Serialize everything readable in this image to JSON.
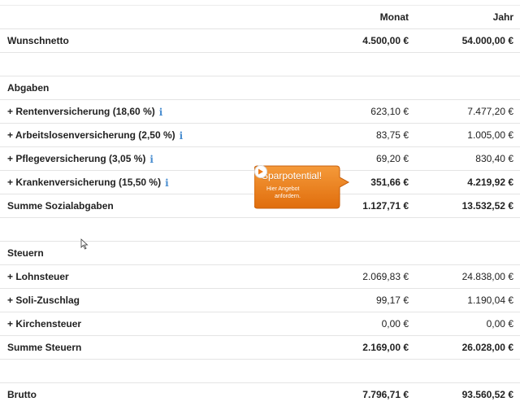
{
  "header": {
    "monat": "Monat",
    "jahr": "Jahr"
  },
  "rows": [
    {
      "label": "Wunschnetto",
      "monat": "4.500,00 €",
      "jahr": "54.000,00 €"
    },
    {
      "label": "",
      "monat": "",
      "jahr": ""
    },
    {
      "label": "Abgaben",
      "monat": "",
      "jahr": ""
    },
    {
      "label": "+ Rentenversicherung  (18,60 %)",
      "monat": "623,10 €",
      "jahr": "7.477,20 €",
      "info": true
    },
    {
      "label": "+ Arbeitslosenversicherung  (2,50 %)",
      "monat": "83,75 €",
      "jahr": "1.005,00 €",
      "info": true
    },
    {
      "label": "+ Pflegeversicherung  (3,05 %)",
      "monat": "69,20 €",
      "jahr": "830,40 €",
      "info": true
    },
    {
      "label": "+ Krankenversicherung  (15,50 %)",
      "monat": "351,66 €",
      "jahr": "4.219,92 €",
      "info": true
    },
    {
      "label": "Summe Sozialabgaben",
      "monat": "1.127,71 €",
      "jahr": "13.532,52 €"
    },
    {
      "label": "",
      "monat": "",
      "jahr": ""
    },
    {
      "label": "Steuern",
      "monat": "",
      "jahr": ""
    },
    {
      "label": "+ Lohnsteuer",
      "monat": "2.069,83 €",
      "jahr": "24.838,00 €"
    },
    {
      "label": "+ Soli-Zuschlag",
      "monat": "99,17 €",
      "jahr": "1.190,04 €"
    },
    {
      "label": "+ Kirchensteuer",
      "monat": "0,00 €",
      "jahr": "0,00 €"
    },
    {
      "label": "Summe Steuern",
      "monat": "2.169,00 €",
      "jahr": "26.028,00 €"
    },
    {
      "label": "",
      "monat": "",
      "jahr": ""
    },
    {
      "label": "Brutto",
      "monat": "7.796,71 €",
      "jahr": "93.560,52 €"
    }
  ],
  "info_icon": {
    "glyph": "i",
    "icon": "info-icon",
    "color": "#4a8ed0"
  },
  "callout": {
    "title": "Sparpotential!",
    "line1": "Hier Angebot",
    "line2": "anfordern.",
    "color": "#ee7a16"
  }
}
